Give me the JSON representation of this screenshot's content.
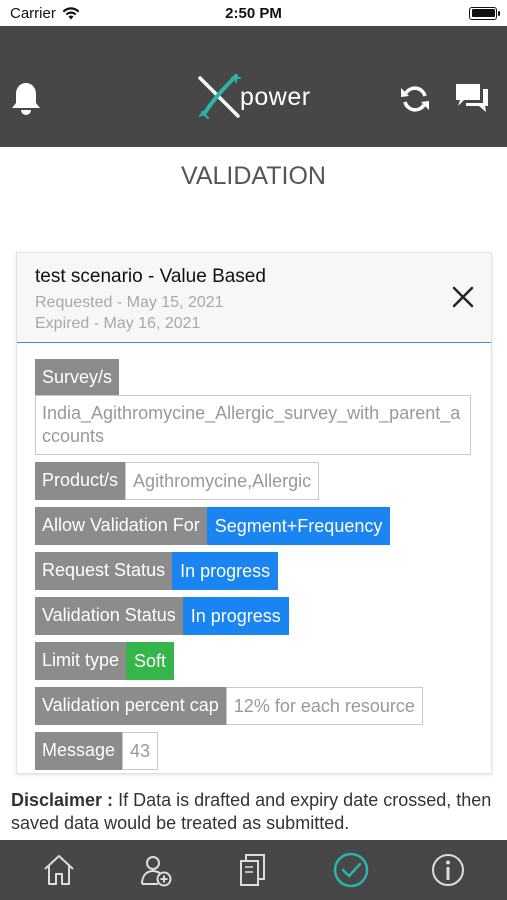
{
  "status_bar": {
    "carrier": "Carrier",
    "time": "2:50 PM"
  },
  "header": {
    "logo_x": "X",
    "logo_text": "power"
  },
  "page": {
    "title": "VALIDATION"
  },
  "card": {
    "title": "test scenario - Value Based",
    "requested": "Requested - May 15, 2021",
    "expired": "Expired - May 16, 2021",
    "fields": {
      "survey_label": "Survey/s",
      "survey_value": "India_Agithromycine_Allergic_survey_with_parent_accounts",
      "product_label": "Product/s",
      "product_value": "Agithromycine,Allergic",
      "allow_label": "Allow Validation For",
      "allow_value": "Segment+Frequency",
      "request_status_label": "Request Status",
      "request_status_value": "In progress",
      "validation_status_label": "Validation Status",
      "validation_status_value": "In progress",
      "limit_label": "Limit type",
      "limit_value": "Soft",
      "cap_label": "Validation percent cap",
      "cap_value": "12% for each resource",
      "message_label": "Message",
      "message_value": "43"
    }
  },
  "disclaimer": {
    "label": "Disclaimer :",
    "text": " If Data is drafted and expiry date crossed, then saved data would be treated as submitted."
  },
  "colors": {
    "header_bg": "#474747",
    "accent_blue": "#1a84f0",
    "accent_green": "#35b54a",
    "logo_teal": "#2bb3ad"
  },
  "tabbar": {
    "items": [
      "home-icon",
      "add-user-icon",
      "documents-icon",
      "check-circle-icon",
      "info-icon"
    ],
    "active": "check-circle-icon"
  }
}
